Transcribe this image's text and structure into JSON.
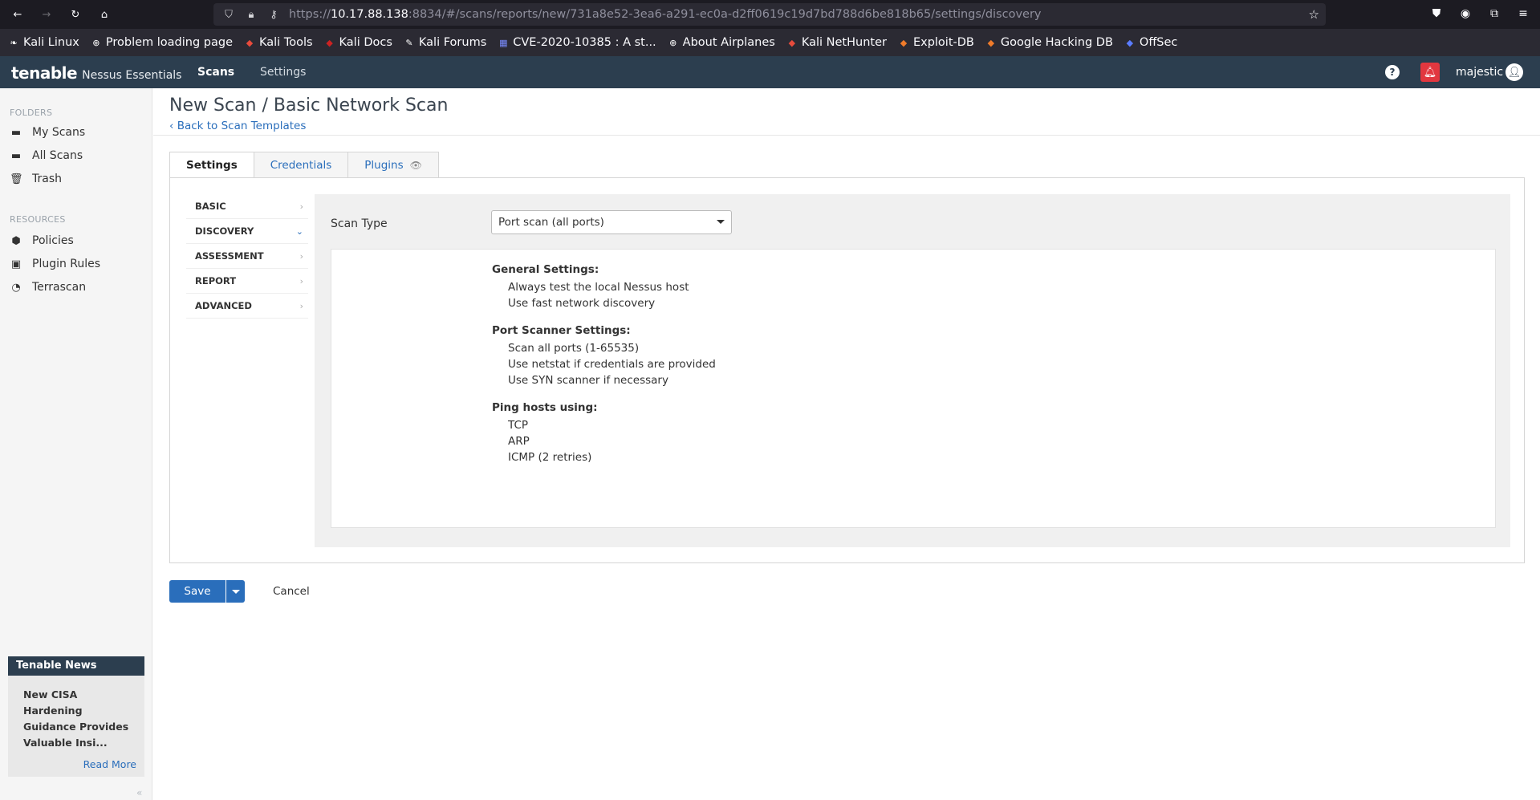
{
  "browser": {
    "url_prefix": "https://",
    "url_host": "10.17.88.138",
    "url_rest": ":8834/#/scans/reports/new/731a8e52-3ea6-a291-ec0a-d2ff0619c19d7bd788d6be818b65/settings/discovery",
    "bookmarks": [
      {
        "label": "Kali Linux",
        "icon": "kali-dragon-icon",
        "color": "#ffffff"
      },
      {
        "label": "Problem loading page",
        "icon": "globe-icon",
        "color": "#ffffff"
      },
      {
        "label": "Kali Tools",
        "icon": "kali-tools-icon",
        "color": "#e84b3c"
      },
      {
        "label": "Kali Docs",
        "icon": "kali-docs-icon",
        "color": "#cc2222"
      },
      {
        "label": "Kali Forums",
        "icon": "kali-forums-icon",
        "color": "#ffffff"
      },
      {
        "label": "CVE-2020-10385 : A st...",
        "icon": "cve-icon",
        "color": "#7a8cff"
      },
      {
        "label": "About Airplanes",
        "icon": "globe-icon",
        "color": "#ffffff"
      },
      {
        "label": "Kali NetHunter",
        "icon": "nethunter-icon",
        "color": "#e84b3c"
      },
      {
        "label": "Exploit-DB",
        "icon": "exploitdb-icon",
        "color": "#f07b2a"
      },
      {
        "label": "Google Hacking DB",
        "icon": "ghdb-icon",
        "color": "#f07b2a"
      },
      {
        "label": "OffSec",
        "icon": "offsec-icon",
        "color": "#5a7cff"
      }
    ]
  },
  "header": {
    "brand": "tenable",
    "product": "Nessus Essentials",
    "nav_scans": "Scans",
    "nav_settings": "Settings",
    "user": "majestic",
    "help_glyph": "?"
  },
  "sidebar": {
    "folders_heading": "FOLDERS",
    "folders": [
      {
        "label": "My Scans",
        "icon": "folder-icon"
      },
      {
        "label": "All Scans",
        "icon": "folder-icon"
      },
      {
        "label": "Trash",
        "icon": "trash-icon"
      }
    ],
    "resources_heading": "RESOURCES",
    "resources": [
      {
        "label": "Policies",
        "icon": "policy-icon"
      },
      {
        "label": "Plugin Rules",
        "icon": "plugin-rules-icon"
      },
      {
        "label": "Terrascan",
        "icon": "terrascan-icon"
      }
    ],
    "news": {
      "title": "Tenable News",
      "headline": "New CISA Hardening Guidance Provides Valuable Insi...",
      "read_more": "Read More"
    }
  },
  "main": {
    "title": "New Scan / Basic Network Scan",
    "back_link": "Back to Scan Templates",
    "tabs": [
      {
        "label": "Settings",
        "active": true
      },
      {
        "label": "Credentials",
        "active": false
      },
      {
        "label": "Plugins",
        "active": false
      }
    ],
    "sections": [
      {
        "label": "BASIC",
        "active": false
      },
      {
        "label": "DISCOVERY",
        "active": true
      },
      {
        "label": "ASSESSMENT",
        "active": false
      },
      {
        "label": "REPORT",
        "active": false
      },
      {
        "label": "ADVANCED",
        "active": false
      }
    ],
    "scan_type_label": "Scan Type",
    "scan_type_value": "Port scan (all ports)",
    "summary": {
      "general_heading": "General Settings:",
      "general": [
        "Always test the local Nessus host",
        "Use fast network discovery"
      ],
      "port_heading": "Port Scanner Settings:",
      "port": [
        "Scan all ports (1-65535)",
        "Use netstat if credentials are provided",
        "Use SYN scanner if necessary"
      ],
      "ping_heading": "Ping hosts using:",
      "ping": [
        "TCP",
        "ARP",
        "ICMP (2 retries)"
      ]
    },
    "save_label": "Save",
    "cancel_label": "Cancel"
  },
  "colors": {
    "header_bg": "#2c3e4f",
    "link": "#2a6ebb",
    "bell": "#e2373f"
  }
}
